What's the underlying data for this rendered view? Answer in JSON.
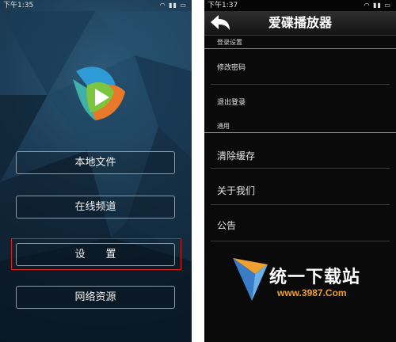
{
  "left_screen": {
    "status_time": "下午1:35",
    "status_icons": "◠ ▮▮ ▭",
    "menu": {
      "local_files": "本地文件",
      "online_channels": "在线频道",
      "settings": "设　　置",
      "network_resources": "网络资源"
    }
  },
  "right_screen": {
    "status_time": "下午1:37",
    "status_icons": "◠ ▮▮ ▭",
    "title": "爱碟播放器",
    "sections": {
      "login": "登录设置",
      "general": "通用"
    },
    "items": {
      "change_password": "修改密码",
      "logout": "退出登录",
      "clear_cache": "清除缓存",
      "about_us": "关于我们",
      "notice": "公告"
    }
  },
  "watermark": {
    "name": "统一下载站",
    "url": "www.3987.Com"
  },
  "colors": {
    "highlight_box": "#d81d1d",
    "logo_green": "#7cc53e",
    "logo_blue": "#2e9bd6",
    "logo_orange": "#e8782a"
  }
}
